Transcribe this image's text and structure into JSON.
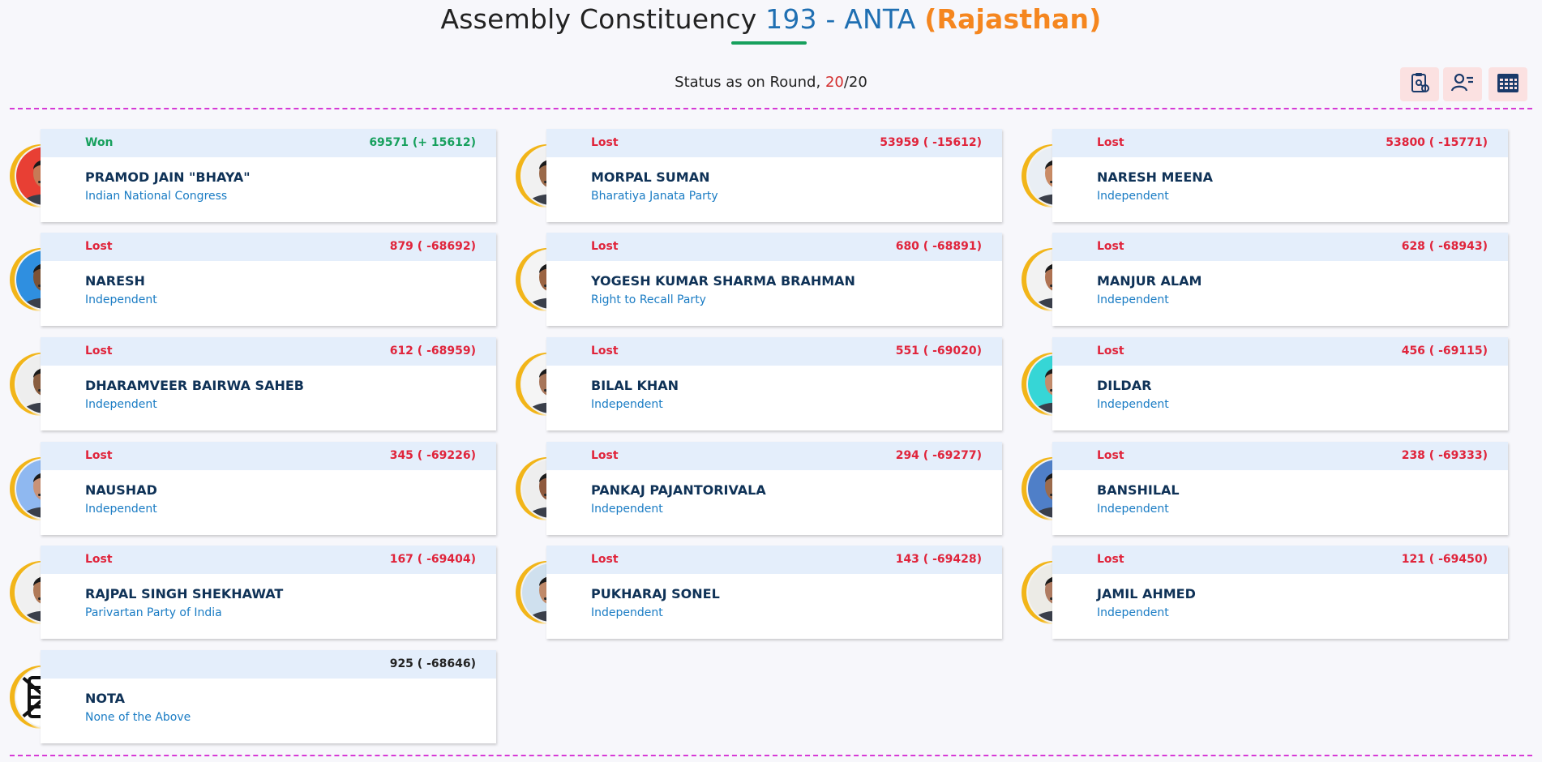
{
  "header": {
    "title_prefix": "Assembly Constituency",
    "ac_number": "193",
    "ac_name": "- ANTA",
    "state": "(Rajasthan)"
  },
  "status": {
    "label": "Status as on Round,",
    "current_round": "20",
    "separator": "/",
    "total_rounds": "20"
  },
  "toolbar": {
    "buttons": [
      "clipboard-chart-icon",
      "user-list-icon",
      "calendar-grid-icon"
    ]
  },
  "colors": {
    "won": "#17a05d",
    "lost": "#e0243b",
    "accent_blue": "#1f6fb2",
    "state_orange": "#f5861f",
    "divider_magenta": "#d63ad6"
  },
  "candidates": [
    {
      "result": "Won",
      "votes": "69571 (+ 15612)",
      "name": "PRAMOD JAIN \"BHAYA\"",
      "party": "Indian National Congress",
      "photo_bg": "#e83f34",
      "skin": "#c77a56"
    },
    {
      "result": "Lost",
      "votes": "53959 ( -15612)",
      "name": "MORPAL SUMAN",
      "party": "Bharatiya Janata Party",
      "photo_bg": "#f1f1f1",
      "skin": "#9b6a4a"
    },
    {
      "result": "Lost",
      "votes": "53800 ( -15771)",
      "name": "NARESH MEENA",
      "party": "Independent",
      "photo_bg": "#e9eef4",
      "skin": "#c98b66"
    },
    {
      "result": "Lost",
      "votes": "879 ( -68692)",
      "name": "NARESH",
      "party": "Independent",
      "photo_bg": "#2f8fe0",
      "skin": "#7c5236"
    },
    {
      "result": "Lost",
      "votes": "680 ( -68891)",
      "name": "YOGESH KUMAR SHARMA BRAHMAN",
      "party": "Right to Recall Party",
      "photo_bg": "#f4f4f4",
      "skin": "#9b6442"
    },
    {
      "result": "Lost",
      "votes": "628 ( -68943)",
      "name": "MANJUR ALAM",
      "party": "Independent",
      "photo_bg": "#f2f2f2",
      "skin": "#b07352"
    },
    {
      "result": "Lost",
      "votes": "612 ( -68959)",
      "name": "DHARAMVEER BAIRWA SAHEB",
      "party": "Independent",
      "photo_bg": "#eeeeee",
      "skin": "#8a5e40"
    },
    {
      "result": "Lost",
      "votes": "551 ( -69020)",
      "name": "BILAL KHAN",
      "party": "Independent",
      "photo_bg": "#f5f5f5",
      "skin": "#a8765a"
    },
    {
      "result": "Lost",
      "votes": "456 ( -69115)",
      "name": "DILDAR",
      "party": "Independent",
      "photo_bg": "#36d6d6",
      "skin": "#c48c6c"
    },
    {
      "result": "Lost",
      "votes": "345 ( -69226)",
      "name": "NAUSHAD",
      "party": "Independent",
      "photo_bg": "#8fb8f0",
      "skin": "#c99278"
    },
    {
      "result": "Lost",
      "votes": "294 ( -69277)",
      "name": "PANKAJ PAJANTORIVALA",
      "party": "Independent",
      "photo_bg": "#eeeeee",
      "skin": "#8f5a3e"
    },
    {
      "result": "Lost",
      "votes": "238 ( -69333)",
      "name": "BANSHILAL",
      "party": "Independent",
      "photo_bg": "#4f7fc8",
      "skin": "#9c6b4c"
    },
    {
      "result": "Lost",
      "votes": "167 ( -69404)",
      "name": "RAJPAL SINGH SHEKHAWAT",
      "party": "Parivartan Party of India",
      "photo_bg": "#f0f0f0",
      "skin": "#b07a58"
    },
    {
      "result": "Lost",
      "votes": "143 ( -69428)",
      "name": "PUKHARAJ SONEL",
      "party": "Independent",
      "photo_bg": "#cfe0ee",
      "skin": "#c08a6a"
    },
    {
      "result": "Lost",
      "votes": "121 ( -69450)",
      "name": "JAMIL AHMED",
      "party": "Independent",
      "photo_bg": "#ecebe6",
      "skin": "#b07c62"
    },
    {
      "result": "",
      "votes": "925 ( -68646)",
      "name": "NOTA",
      "party": "None of the Above",
      "photo_bg": "#ffffff",
      "skin": "none",
      "is_nota": true
    }
  ]
}
